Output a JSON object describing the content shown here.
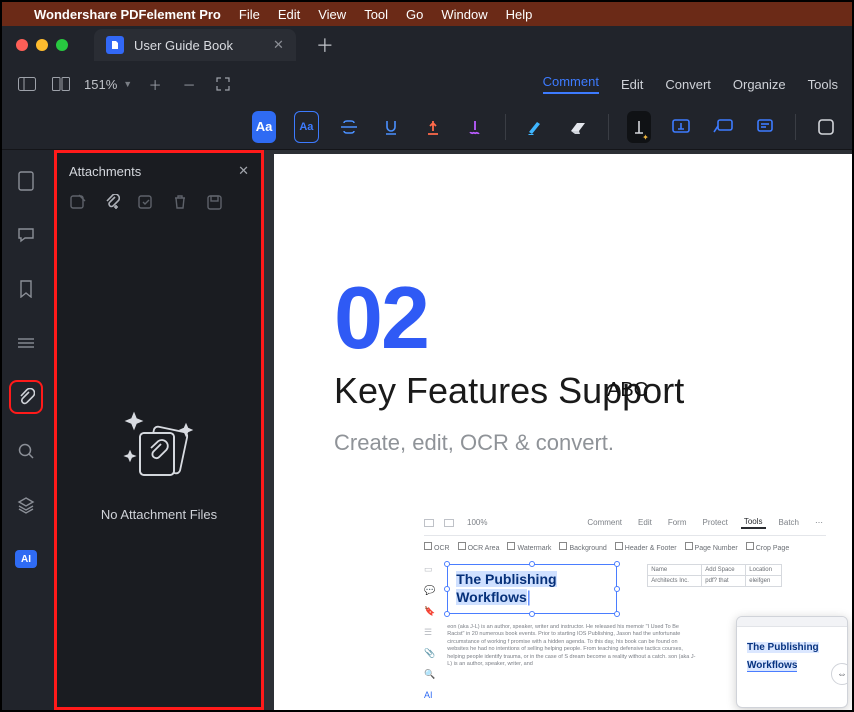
{
  "menubar": {
    "apple": "",
    "appname": "Wondershare PDFelement Pro",
    "items": [
      "File",
      "Edit",
      "View",
      "Tool",
      "Go",
      "Window",
      "Help"
    ]
  },
  "tab": {
    "title": "User Guide Book"
  },
  "toolbar": {
    "zoom": "151%",
    "tabs": [
      "Comment",
      "Edit",
      "Convert",
      "Organize",
      "Tools"
    ]
  },
  "sidepanel": {
    "title": "Attachments",
    "empty_msg": "No Attachment Files"
  },
  "ai_label": "AI",
  "document": {
    "num": "02",
    "annotation": "ABC",
    "heading": "Key Features Support",
    "sub": "Create, edit, OCR & convert.",
    "embedded": {
      "views": [
        "100%"
      ],
      "tabs": [
        "Comment",
        "Edit",
        "Form",
        "Protect",
        "Tools",
        "Batch"
      ],
      "subtools": [
        "OCR",
        "OCR Area",
        "Watermark",
        "Background",
        "Header & Footer",
        "Page Number",
        "Crop Page"
      ],
      "selection_l1": "The Publishing",
      "selection_l2": "Workflows",
      "table": {
        "headers": [
          "Name",
          "Add Space",
          "Location"
        ],
        "rows": [
          [
            "Architects Inc.",
            "pdf? that",
            "eleifgen"
          ]
        ]
      },
      "paragraph": "eon (aka J-L) is an author, speaker, writer and instructor. He released his memoir \"I Used To Be Racist\" in 20 numerous book events. Prior to starting IOS Publishing, Jason had the unfortunate circumstance of working f promise with a hidden agenda. To this day, his book can be found on websites he had no intentions of selling helping people. From teaching defensive tactics courses, helping people identify trauma, or in the case of S dream become a reality without a catch.\n\nson (aka J-L) is an author, speaker, writer, and",
      "float_l1": "The Publishing",
      "float_l2": "Workflows"
    }
  }
}
